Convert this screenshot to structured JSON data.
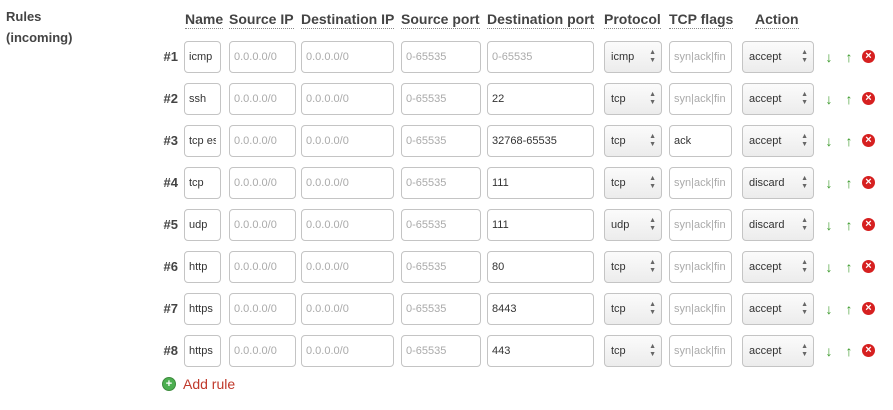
{
  "section": {
    "label_line1": "Rules",
    "label_line2": "(incoming)"
  },
  "headers": {
    "name": "Name",
    "source_ip": "Source IP",
    "destination_ip": "Destination IP",
    "source_port": "Source port",
    "destination_port": "Destination port",
    "protocol": "Protocol",
    "tcp_flags": "TCP flags",
    "action": "Action"
  },
  "placeholders": {
    "source_ip": "0.0.0.0/0",
    "destination_ip": "0.0.0.0/0",
    "source_port": "0-65535",
    "destination_port": "0-65535",
    "tcp_flags": "syn|ack|fin"
  },
  "rules": [
    {
      "num": "#1",
      "name": "icmp",
      "source_ip": "",
      "destination_ip": "",
      "source_port": "",
      "destination_port": "",
      "protocol": "icmp",
      "tcp_flags": "",
      "action": "accept"
    },
    {
      "num": "#2",
      "name": "ssh",
      "source_ip": "",
      "destination_ip": "",
      "source_port": "",
      "destination_port": "22",
      "protocol": "tcp",
      "tcp_flags": "",
      "action": "accept"
    },
    {
      "num": "#3",
      "name": "tcp es",
      "source_ip": "",
      "destination_ip": "",
      "source_port": "",
      "destination_port": "32768-65535",
      "protocol": "tcp",
      "tcp_flags": "ack",
      "action": "accept"
    },
    {
      "num": "#4",
      "name": "tcp",
      "source_ip": "",
      "destination_ip": "",
      "source_port": "",
      "destination_port": "111",
      "protocol": "tcp",
      "tcp_flags": "",
      "action": "discard"
    },
    {
      "num": "#5",
      "name": "udp",
      "source_ip": "",
      "destination_ip": "",
      "source_port": "",
      "destination_port": "111",
      "protocol": "udp",
      "tcp_flags": "",
      "action": "discard"
    },
    {
      "num": "#6",
      "name": "http",
      "source_ip": "",
      "destination_ip": "",
      "source_port": "",
      "destination_port": "80",
      "protocol": "tcp",
      "tcp_flags": "",
      "action": "accept"
    },
    {
      "num": "#7",
      "name": "https",
      "source_ip": "",
      "destination_ip": "",
      "source_port": "",
      "destination_port": "8443",
      "protocol": "tcp",
      "tcp_flags": "",
      "action": "accept"
    },
    {
      "num": "#8",
      "name": "https",
      "source_ip": "",
      "destination_ip": "",
      "source_port": "",
      "destination_port": "443",
      "protocol": "tcp",
      "tcp_flags": "",
      "action": "accept"
    }
  ],
  "add_rule": {
    "label": "Add rule"
  },
  "icons": {
    "down": "arrow-down-icon",
    "up": "arrow-up-icon",
    "delete": "delete-icon",
    "add": "add-icon"
  },
  "colors": {
    "arrow": "#3a9a2a",
    "delete": "#d62020",
    "add_link": "#c0392b",
    "add_icon": "#4caf50"
  }
}
